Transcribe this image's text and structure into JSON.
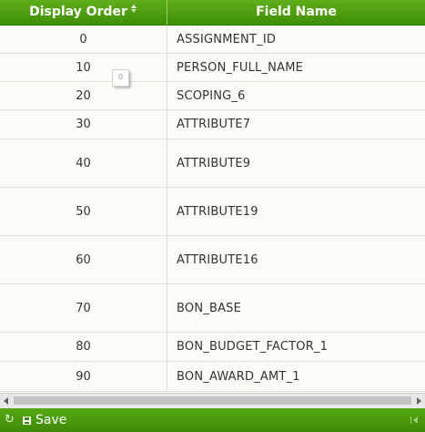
{
  "columns": {
    "display_order": "Display Order",
    "field_name": "Field Name"
  },
  "sort": {
    "column": "display_order",
    "icon": "sort-icon"
  },
  "rows": [
    {
      "order": "0",
      "field": "ASSIGNMENT_ID"
    },
    {
      "order": "10",
      "field": "PERSON_FULL_NAME"
    },
    {
      "order": "20",
      "field": "SCOPING_6"
    },
    {
      "order": "30",
      "field": "ATTRIBUTE7"
    },
    {
      "order": "40",
      "field": "ATTRIBUTE9"
    },
    {
      "order": "50",
      "field": "ATTRIBUTE19"
    },
    {
      "order": "60",
      "field": "ATTRIBUTE16"
    },
    {
      "order": "70",
      "field": "BON_BASE"
    },
    {
      "order": "80",
      "field": "BON_BUDGET_FACTOR_1"
    },
    {
      "order": "90",
      "field": "BON_AWARD_AMT_1"
    }
  ],
  "tooltip": {
    "text": "0"
  },
  "footer": {
    "save_label": "Save",
    "refresh_icon": "refresh-icon",
    "save_icon": "disk-icon",
    "end_icon": "end-icon"
  },
  "colors": {
    "header_green": "#4a9c0f",
    "footer_green": "#4a9c0f",
    "row_bg": "#fbfbf7",
    "border": "#e3e0cf"
  }
}
